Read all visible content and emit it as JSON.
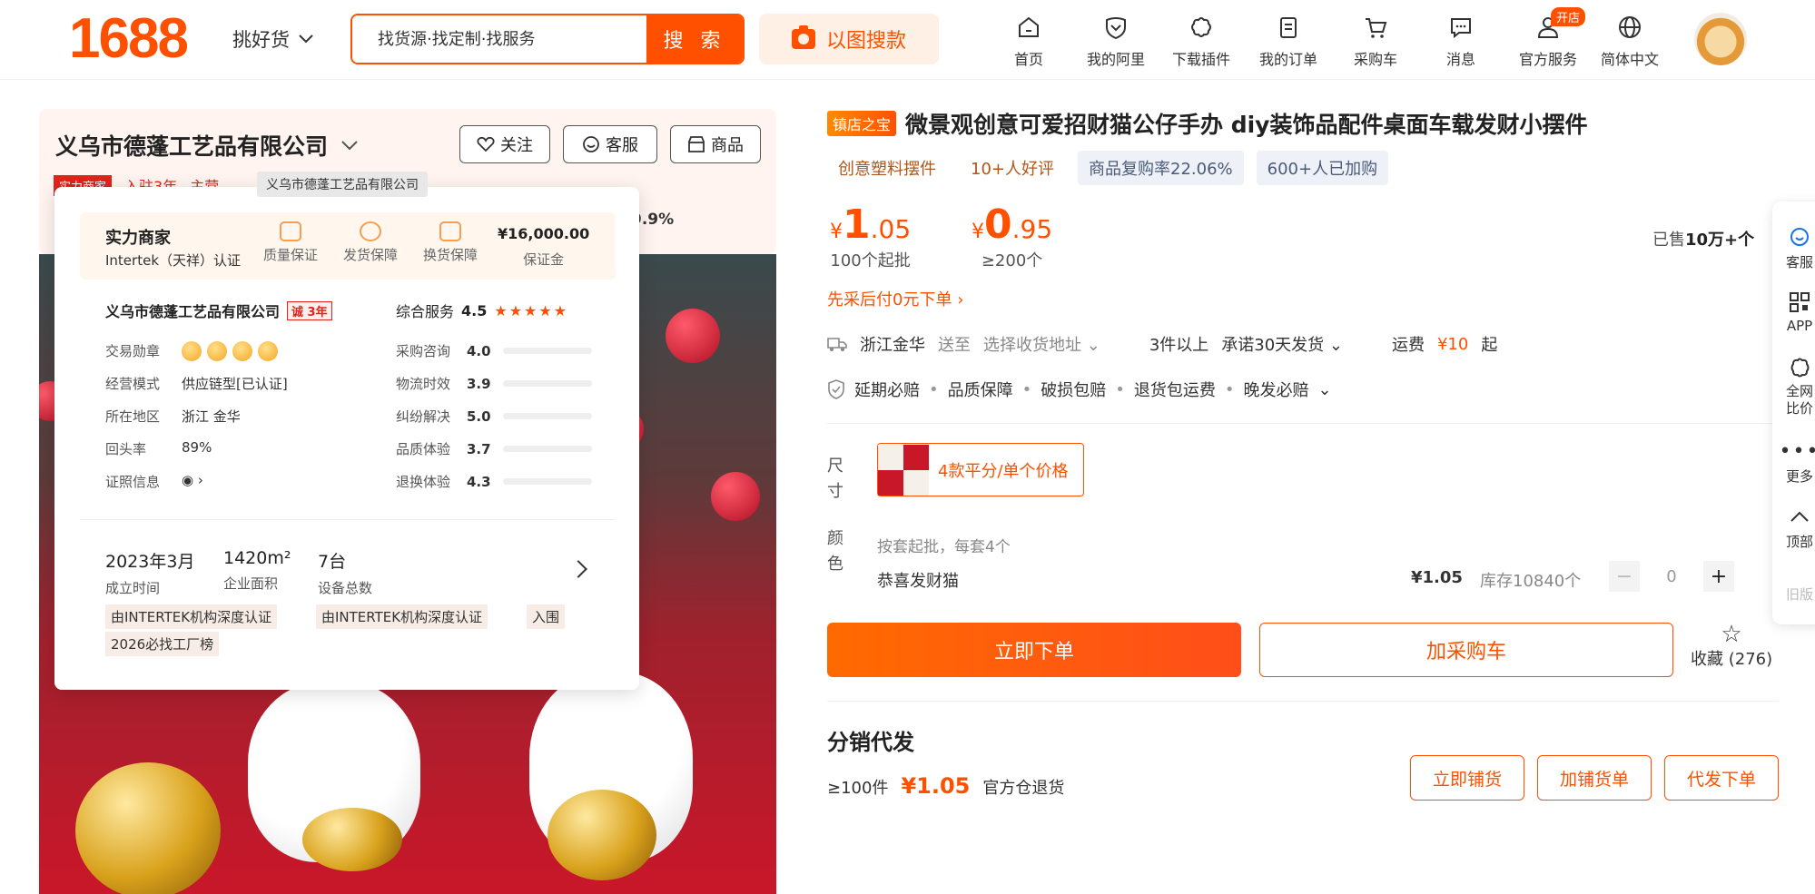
{
  "header": {
    "logo": "1688",
    "pick_label": "挑好货",
    "search_placeholder": "找货源·找定制·找服务",
    "search_button": "搜 索",
    "image_search": "以图搜款",
    "nav": [
      {
        "label": "首页",
        "icon": "home-icon"
      },
      {
        "label": "我的阿里",
        "icon": "heart-shield-icon"
      },
      {
        "label": "下载插件",
        "icon": "plugin-icon"
      },
      {
        "label": "我的订单",
        "icon": "clipboard-icon"
      },
      {
        "label": "采购车",
        "icon": "cart-icon"
      },
      {
        "label": "消息",
        "icon": "message-icon"
      },
      {
        "label": "官方服务",
        "icon": "user-icon",
        "badge": "开店"
      },
      {
        "label": "简体中文",
        "icon": "globe-icon"
      }
    ]
  },
  "store": {
    "name": "义乌市德蓬工艺品有限公司",
    "tooltip": "义乌市德蓬工艺品有限公司",
    "follow": "关注",
    "service": "客服",
    "goods": "商品",
    "strip_tag": "实力商家",
    "strip_years": "入驻3年",
    "strip_more": "主营",
    "percent_peek": "9.9%"
  },
  "card": {
    "title": "实力商家",
    "subtitle": "Intertek（天祥）认证",
    "guarantees": [
      "质量保证",
      "发货保障",
      "换货保障"
    ],
    "deposit_value": "¥16,000.00",
    "deposit_label": "保证金",
    "company": "义乌市德蓬工艺品有限公司",
    "cheng": "诚 3年",
    "rows": [
      {
        "k": "交易勋章",
        "v": ""
      },
      {
        "k": "经营模式",
        "v": "供应链型[已认证]"
      },
      {
        "k": "所在地区",
        "v": "浙江 金华"
      },
      {
        "k": "回头率",
        "v": "89%"
      },
      {
        "k": "证照信息",
        "v": ""
      }
    ],
    "score_label": "综合服务",
    "score_value": "4.5",
    "scores": [
      {
        "k": "采购咨询",
        "v": "4.0",
        "fill": 0.8
      },
      {
        "k": "物流时效",
        "v": "3.9",
        "fill": 0.78
      },
      {
        "k": "纠纷解决",
        "v": "5.0",
        "fill": 1.0
      },
      {
        "k": "品质体验",
        "v": "3.7",
        "fill": 0.74
      },
      {
        "k": "退换体验",
        "v": "4.3",
        "fill": 0.86
      }
    ],
    "stats": [
      {
        "v": "2023年3月",
        "l": "成立时间"
      },
      {
        "v": "1420m²",
        "l": "企业面积"
      },
      {
        "v": "7台",
        "l": "设备总数"
      }
    ],
    "certs": [
      "由INTERTEK机构深度认证",
      "由INTERTEK机构深度认证",
      "入围",
      "2026必找工厂榜"
    ]
  },
  "product": {
    "badge": "镇店之宝",
    "title": "微景观创意可爱招财猫公仔手办 diy装饰品配件桌面车载发财小摆件",
    "chips": [
      "创意塑料摆件",
      "10+人好评",
      "商品复购率22.06%",
      "600+人已加购"
    ],
    "prices": [
      {
        "cur": "¥",
        "int": "1",
        "dec": ".05",
        "q": "100个起批"
      },
      {
        "cur": "¥",
        "int": "0",
        "dec": ".95",
        "q": "≥200个"
      }
    ],
    "sold_prefix": "已售",
    "sold_value": "10万+个",
    "paylater": "先采后付0元下单",
    "ship_from": "浙江金华",
    "ship_to": "送至",
    "ship_addr": "选择收货地址",
    "ship_qty": "3件以上",
    "ship_promise": "承诺30天发货",
    "freight_label": "运费",
    "freight_value": "¥10",
    "freight_suffix": "起",
    "ensure": [
      "延期必赔",
      "品质保障",
      "破损包赔",
      "退货包运费",
      "晚发必赔"
    ],
    "size_label": "尺寸",
    "size_option": "4款平分/单个价格",
    "color_label": "颜色",
    "hint": "按套起批，每套4个",
    "color_name": "恭喜发财猫",
    "unit_price": "¥1.05",
    "stock": "库存10840个",
    "qty": "0",
    "buy": "立即下单",
    "cart": "加采购车",
    "fav": "收藏 (276)",
    "dist_title": "分销代发",
    "dist_qty": "≥100件",
    "dist_price": "¥1.05",
    "dist_note": "官方仓退货",
    "dist_buttons": [
      "立即铺货",
      "加铺货单",
      "代发下单"
    ]
  },
  "sidebar": [
    {
      "label": "客服",
      "icon": "service-icon"
    },
    {
      "label": "APP",
      "icon": "qr-code-icon"
    },
    {
      "label": "全网比价",
      "icon": "compare-icon"
    },
    {
      "label": "更多",
      "icon": "more-dots-icon"
    },
    {
      "label": "顶部",
      "icon": "chevron-up-icon"
    },
    {
      "label": "旧版",
      "icon": ""
    }
  ],
  "colors": {
    "brand": "#ff5000",
    "red": "#e2231a"
  }
}
